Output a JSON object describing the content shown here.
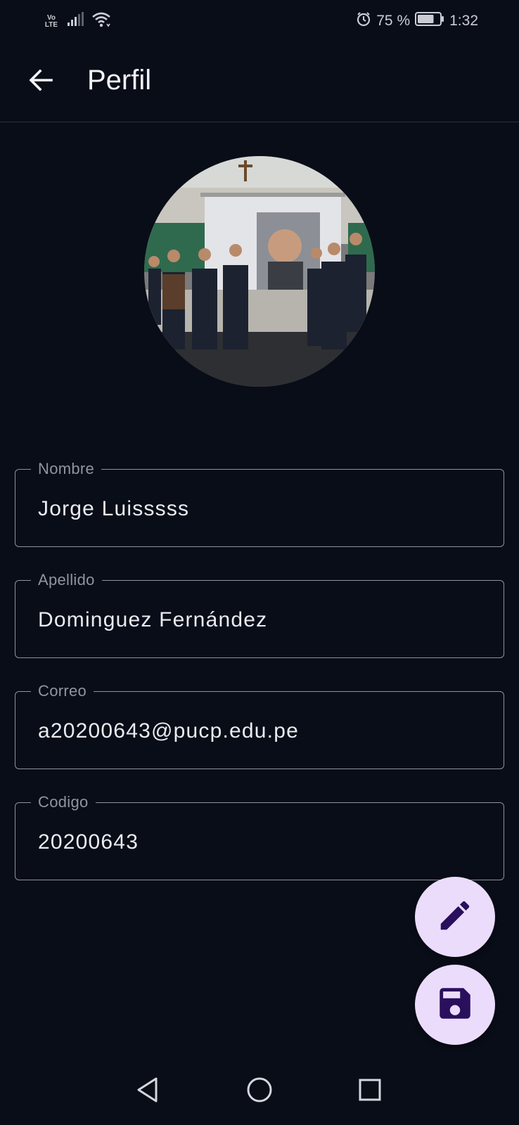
{
  "status_bar": {
    "network_top": "Vo",
    "network_bottom": "LTE",
    "battery_percent": "75 %",
    "battery_level": 0.75,
    "time": "1:32",
    "icons": [
      "signal-icon",
      "wifi-icon",
      "alarm-icon",
      "battery-icon"
    ]
  },
  "app_bar": {
    "title": "Perfil",
    "back_icon": "arrow-back-icon"
  },
  "profile": {
    "photo_icon": "profile-photo"
  },
  "fields": {
    "nombre": {
      "label": "Nombre",
      "value": "Jorge Luisssss"
    },
    "apellido": {
      "label": "Apellido",
      "value": "Dominguez Fernández"
    },
    "correo": {
      "label": "Correo",
      "value": "a20200643@pucp.edu.pe"
    },
    "codigo": {
      "label": "Codigo",
      "value": "20200643"
    }
  },
  "fabs": {
    "edit_icon": "pencil-icon",
    "save_icon": "floppy-disk-icon"
  },
  "nav": {
    "icons": [
      "back-triangle-icon",
      "home-circle-icon",
      "recents-square-icon"
    ]
  },
  "colors": {
    "background": "#090d18",
    "fab_background": "#ebdcfc",
    "fab_icon": "#2a0f5c",
    "field_border": "#8d929e",
    "label_text": "#8f94a0",
    "value_text": "#e9ebf0"
  }
}
